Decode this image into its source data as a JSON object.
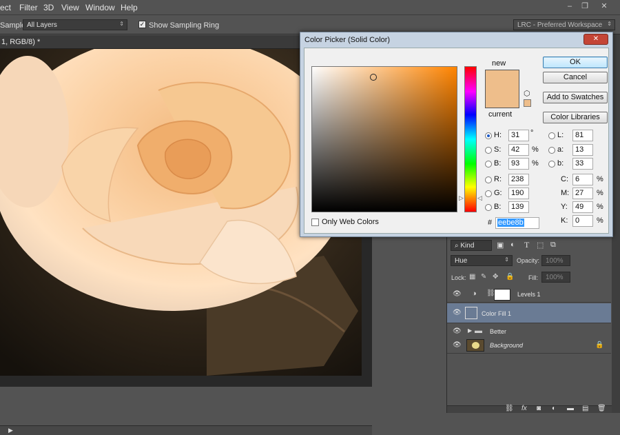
{
  "menubar": {
    "items": [
      "ect",
      "Filter",
      "3D",
      "View",
      "Window",
      "Help"
    ],
    "controls": [
      "–",
      "❐",
      "✕"
    ]
  },
  "options": {
    "sample_label": "Sample:",
    "sample_value": "All Layers",
    "sampling_ring_label": "Show Sampling Ring",
    "sampling_ring_checked": true,
    "workspace": "LRC - Preferred Workspace"
  },
  "document": {
    "tab_title": "1, RGB/8) *"
  },
  "dialog": {
    "title": "Color Picker (Solid Color)",
    "close": "✕",
    "new_label": "new",
    "current_label": "current",
    "new_color": "#eebe8b",
    "current_color": "#eebe8b",
    "buttons": {
      "ok": "OK",
      "cancel": "Cancel",
      "add_swatches": "Add to Swatches",
      "color_libraries": "Color Libraries"
    },
    "hsb": [
      {
        "label": "H:",
        "value": "31",
        "unit": "°",
        "selected": true
      },
      {
        "label": "S:",
        "value": "42",
        "unit": "%",
        "selected": false
      },
      {
        "label": "B:",
        "value": "93",
        "unit": "%",
        "selected": false
      }
    ],
    "rgb": [
      {
        "label": "R:",
        "value": "238"
      },
      {
        "label": "G:",
        "value": "190"
      },
      {
        "label": "B:",
        "value": "139"
      }
    ],
    "lab": [
      {
        "label": "L:",
        "value": "81"
      },
      {
        "label": "a:",
        "value": "13"
      },
      {
        "label": "b:",
        "value": "33"
      }
    ],
    "cmyk": [
      {
        "label": "C:",
        "value": "6",
        "unit": "%"
      },
      {
        "label": "M:",
        "value": "27",
        "unit": "%"
      },
      {
        "label": "Y:",
        "value": "49",
        "unit": "%"
      },
      {
        "label": "K:",
        "value": "0",
        "unit": "%"
      }
    ],
    "hex_label": "#",
    "hex_value": "eebe8b",
    "only_web_colors": "Only Web Colors",
    "field_hue_color": "#ff8400"
  },
  "layers_panel": {
    "filter_kind": "Kind",
    "blend_mode": "Hue",
    "opacity_label": "Opacity:",
    "opacity_value": "100%",
    "lock_label": "Lock:",
    "fill_label": "Fill:",
    "fill_value": "100%",
    "layers": [
      {
        "name": "Levels 1",
        "selected": false
      },
      {
        "name": "Color Fill 1",
        "selected": true
      },
      {
        "name": "Better",
        "selected": false
      },
      {
        "name": "Background",
        "selected": false
      }
    ]
  }
}
